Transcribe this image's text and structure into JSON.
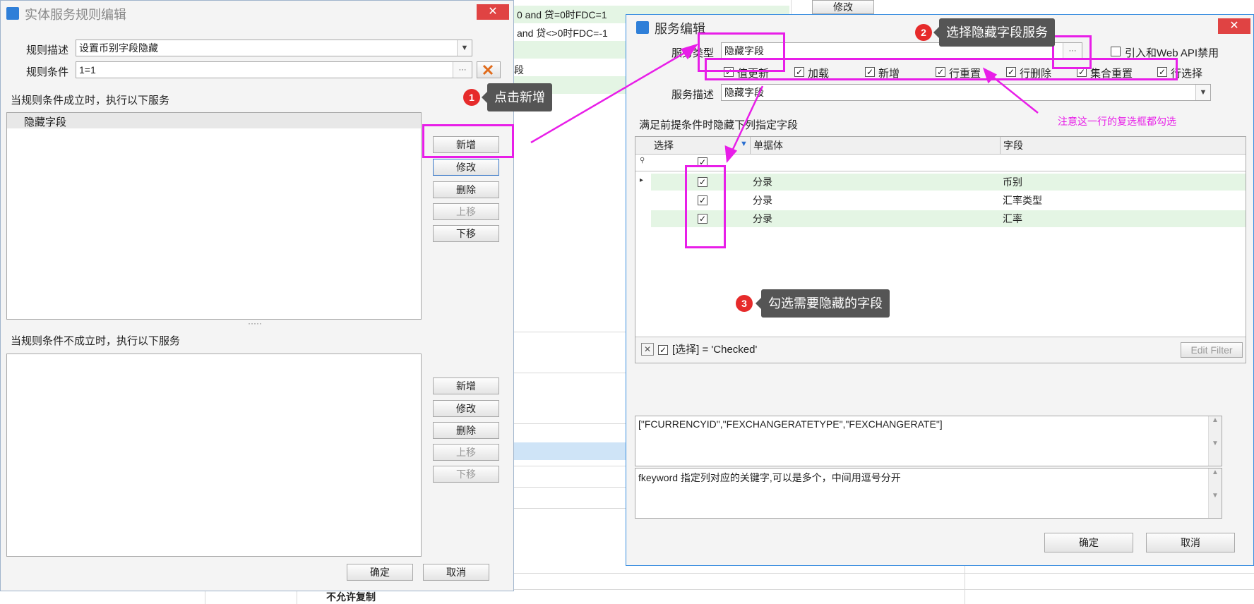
{
  "background": {
    "rows": [
      "0 and 贷=0时FDC=1",
      "and 贷<>0时FDC=-1",
      "段"
    ],
    "modify_button": "修改",
    "bottom_text": "不允许复制"
  },
  "rule_dialog": {
    "title": "实体服务规则编辑",
    "close": "✕",
    "desc_label": "规则描述",
    "desc_value": "设置币别字段隐藏",
    "cond_label": "规则条件",
    "cond_value": "1=1",
    "ellipsis": "···",
    "true_caption": "当规则条件成立时，执行以下服务",
    "true_items": [
      "隐藏字段"
    ],
    "false_caption": "当规则条件不成立时，执行以下服务",
    "splitter": "·····",
    "buttons": {
      "add": "新增",
      "modify": "修改",
      "delete": "删除",
      "up": "上移",
      "down": "下移"
    },
    "ok": "确定",
    "cancel": "取消"
  },
  "service_dialog": {
    "title": "服务编辑",
    "close": "✕",
    "type_label": "服务类型",
    "type_value": "隐藏字段",
    "ellipsis": "···",
    "webapi_label": "引入和Web API禁用",
    "checkboxes": [
      {
        "label": "值更新",
        "checked": true
      },
      {
        "label": "加载",
        "checked": true
      },
      {
        "label": "新增",
        "checked": true
      },
      {
        "label": "行重置",
        "checked": true
      },
      {
        "label": "行删除",
        "checked": true
      },
      {
        "label": "集合重置",
        "checked": true
      },
      {
        "label": "行选择",
        "checked": true
      }
    ],
    "desc_label": "服务描述",
    "desc_value": "隐藏字段",
    "grid_caption": "满足前提条件时隐藏下列指定字段",
    "columns": [
      "选择",
      "单据体",
      "字段"
    ],
    "rows": [
      {
        "entity": "分录",
        "field": "币别"
      },
      {
        "entity": "分录",
        "field": "汇率类型"
      },
      {
        "entity": "分录",
        "field": "汇率"
      }
    ],
    "filter_text": "[选择] = 'Checked'",
    "edit_filter": "Edit Filter",
    "keywords": "[\"FCURRENCYID\",\"FEXCHANGERATETYPE\",\"FEXCHANGERATE\"]",
    "help_text": "fkeyword  指定列对应的关键字,可以是多个，中间用逗号分开",
    "ok": "确定",
    "cancel": "取消"
  },
  "annotations": {
    "step1": {
      "num": "1",
      "text": "点击新增"
    },
    "step2": {
      "num": "2",
      "text": "选择隐藏字段服务"
    },
    "step3": {
      "num": "3",
      "text": "勾选需要隐藏的字段"
    },
    "note": "注意这一行的复选框都勾选",
    "color": "#e81ee8"
  }
}
